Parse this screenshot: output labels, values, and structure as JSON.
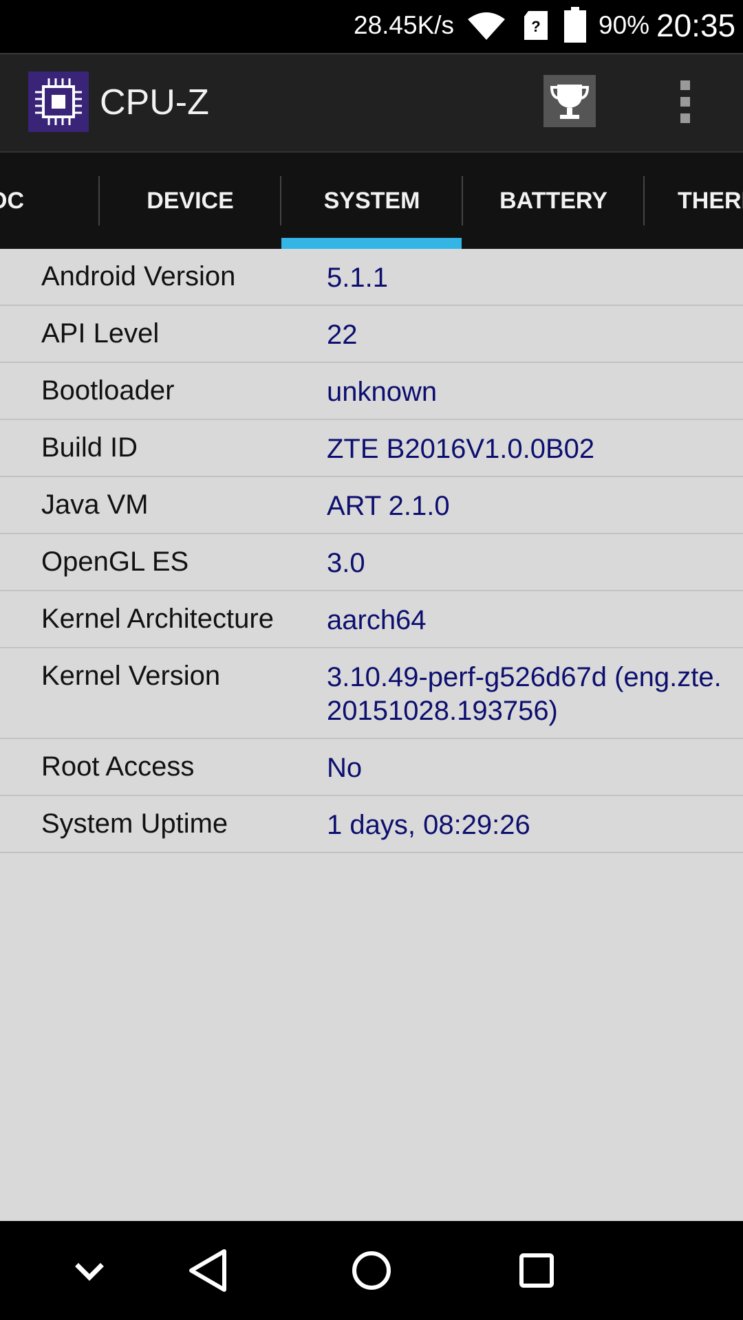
{
  "status_bar": {
    "net_speed": "28.45K/s",
    "battery_percent": "90%",
    "time": "20:35",
    "icons": [
      "wifi-icon",
      "sim-unknown-icon",
      "battery-icon"
    ]
  },
  "app_bar": {
    "title": "CPU-Z",
    "icons": [
      "cpu-z-app-icon",
      "trophy-icon",
      "overflow-menu-icon"
    ]
  },
  "tabs": [
    {
      "label": "OC"
    },
    {
      "label": "DEVICE"
    },
    {
      "label": "SYSTEM",
      "selected": true
    },
    {
      "label": "BATTERY"
    },
    {
      "label": "THERI"
    }
  ],
  "rows": [
    {
      "label": "Android Version",
      "value": "5.1.1"
    },
    {
      "label": "API Level",
      "value": "22"
    },
    {
      "label": "Bootloader",
      "value": "unknown"
    },
    {
      "label": "Build ID",
      "value": "ZTE B2016V1.0.0B02"
    },
    {
      "label": "Java VM",
      "value": "ART 2.1.0"
    },
    {
      "label": "OpenGL ES",
      "value": "3.0"
    },
    {
      "label": "Kernel Architecture",
      "value": "aarch64"
    },
    {
      "label": "Kernel Version",
      "value": "3.10.49-perf-g526d67d (eng.zte.\n20151028.193756)"
    },
    {
      "label": "Root Access",
      "value": "No"
    },
    {
      "label": "System Uptime",
      "value": "1 days, 08:29:26"
    }
  ],
  "nav_bar": {
    "icons": [
      "hide-keyboard-icon",
      "back-icon",
      "home-icon",
      "recents-icon"
    ]
  },
  "colors": {
    "accent": "#33b5e5",
    "value_text": "#0c0f6e",
    "content_bg": "#d9d9d9",
    "tab_bg": "#121212",
    "app_bar_bg": "#212121"
  }
}
